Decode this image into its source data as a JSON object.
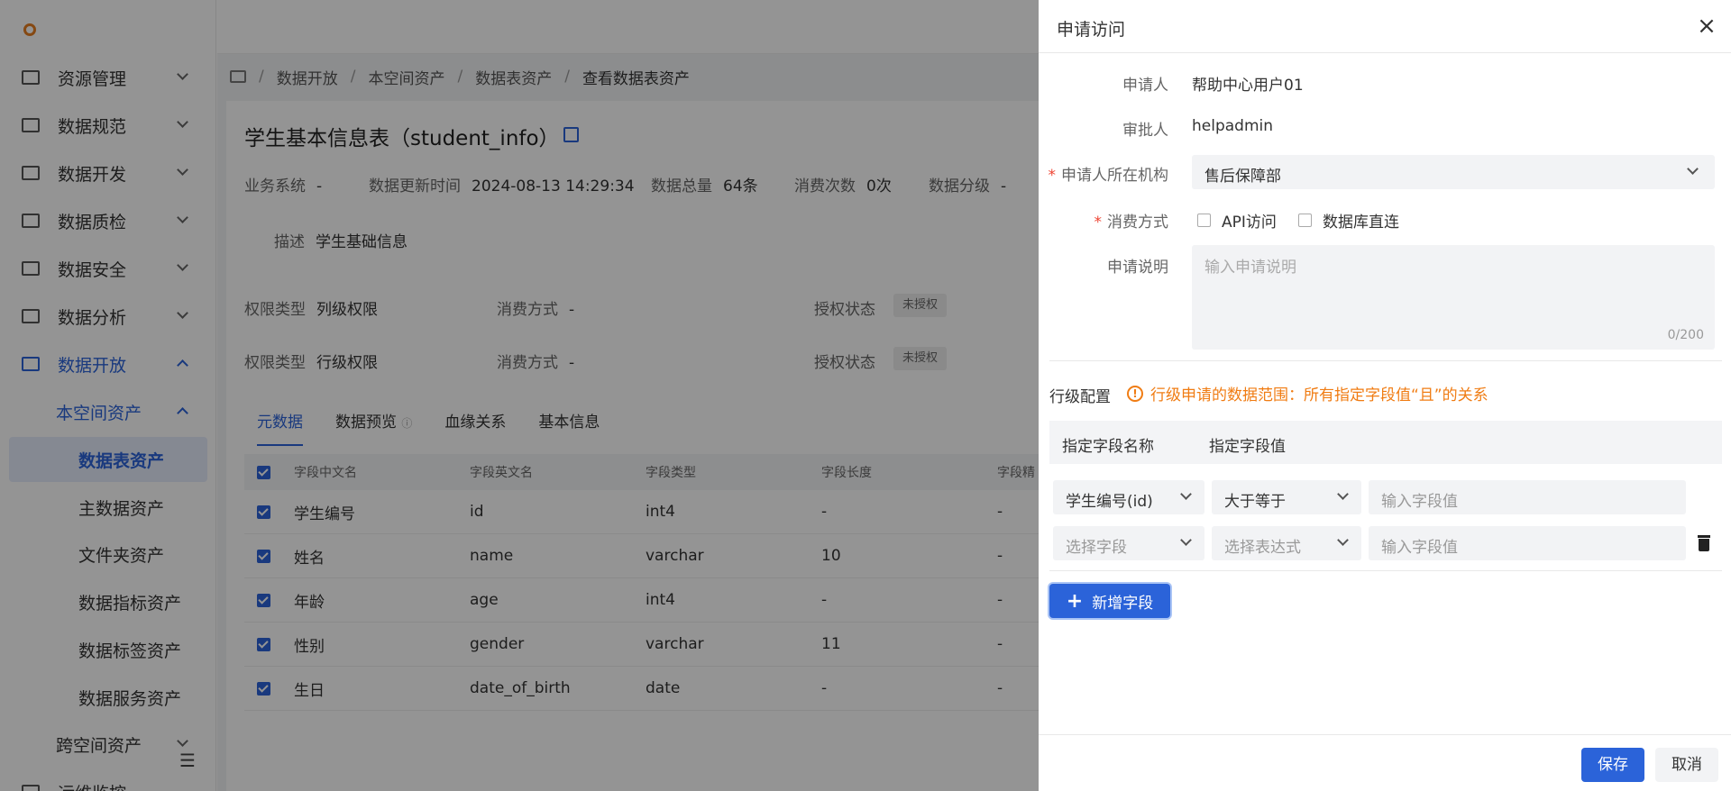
{
  "sidebar": {
    "items": [
      {
        "label": "资源管理",
        "icon": "resource-icon"
      },
      {
        "label": "数据规范",
        "icon": "standard-icon"
      },
      {
        "label": "数据开发",
        "icon": "develop-icon"
      },
      {
        "label": "数据质检",
        "icon": "quality-icon"
      },
      {
        "label": "数据安全",
        "icon": "security-icon"
      },
      {
        "label": "数据分析",
        "icon": "analysis-icon"
      },
      {
        "label": "数据开放",
        "icon": "open-icon"
      }
    ],
    "sub_parent": "本空间资产",
    "sub_items": [
      "数据表资产",
      "主数据资产",
      "文件夹资产",
      "数据指标资产",
      "数据标签资产",
      "数据服务资产"
    ],
    "cross_space": "跨空间资产",
    "ops": "运维监控"
  },
  "breadcrumb": [
    "数据开放",
    "本空间资产",
    "数据表资产",
    "查看数据表资产"
  ],
  "asset": {
    "title": "学生基本信息表（student_info）",
    "meta": [
      {
        "label": "业务系统",
        "value": "-"
      },
      {
        "label": "数据更新时间",
        "value": "2024-08-13 14:29:34"
      },
      {
        "label": "数据总量",
        "value": "64条"
      },
      {
        "label": "消费次数",
        "value": "0次"
      },
      {
        "label": "数据分级",
        "value": "-"
      }
    ],
    "desc_label": "描述",
    "desc_value": "学生基础信息",
    "permissions": [
      {
        "type_label": "权限类型",
        "type_value": "列级权限",
        "consume_label": "消费方式",
        "consume_value": "-",
        "auth_label": "授权状态",
        "auth_value": "未授权"
      },
      {
        "type_label": "权限类型",
        "type_value": "行级权限",
        "consume_label": "消费方式",
        "consume_value": "-",
        "auth_label": "授权状态",
        "auth_value": "未授权"
      }
    ],
    "tabs": [
      "元数据",
      "数据预览",
      "血缘关系",
      "基本信息"
    ],
    "table": {
      "headers": [
        "字段中文名",
        "字段英文名",
        "字段类型",
        "字段长度",
        "字段精"
      ],
      "rows": [
        [
          "学生编号",
          "id",
          "int4",
          "-",
          "-"
        ],
        [
          "姓名",
          "name",
          "varchar",
          "10",
          "-"
        ],
        [
          "年龄",
          "age",
          "int4",
          "-",
          "-"
        ],
        [
          "性别",
          "gender",
          "varchar",
          "11",
          "-"
        ],
        [
          "生日",
          "date_of_birth",
          "date",
          "-",
          "-"
        ]
      ]
    }
  },
  "drawer": {
    "title": "申请访问",
    "close": "×",
    "applicant_label": "申请人",
    "applicant_value": "帮助中心用户01",
    "approver_label": "审批人",
    "approver_value": "helpadmin",
    "org_label": "申请人所在机构",
    "org_value": "售后保障部",
    "consume_label": "消费方式",
    "consume_options": [
      "API访问",
      "数据库直连"
    ],
    "desc_label": "申请说明",
    "desc_placeholder": "输入申请说明",
    "desc_count": "0/200",
    "row_cfg_label": "行级配置",
    "row_cfg_warning": "行级申请的数据范围：所有指定字段值“且”的关系",
    "cfg_headers": [
      "指定字段名称",
      "指定字段值"
    ],
    "cfg_rows": [
      {
        "field": "学生编号(id)",
        "expr": "大于等于",
        "value_placeholder": "输入字段值"
      },
      {
        "field": "选择字段",
        "expr": "选择表达式",
        "value_placeholder": "输入字段值"
      }
    ],
    "add_field": "新增字段",
    "save": "保存",
    "cancel": "取消"
  },
  "colors": {
    "primary": "#2b63d9",
    "warning": "#f07c13",
    "required": "#e43"
  }
}
